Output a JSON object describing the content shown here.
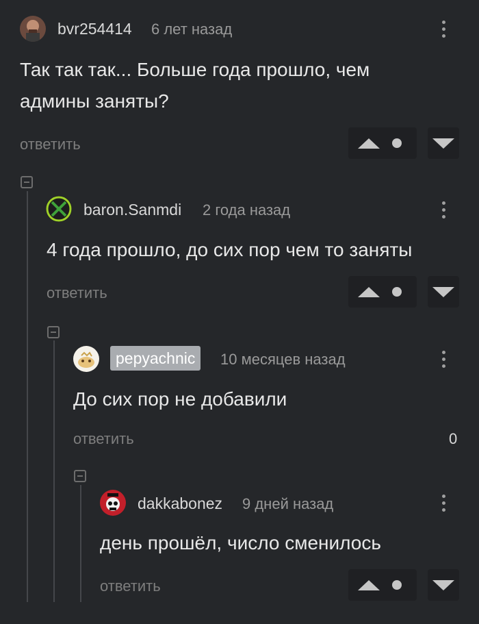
{
  "comments": [
    {
      "username": "bvr254414",
      "time": "6 лет назад",
      "text_line1": "Так так так... Больше года прошло, чем",
      "text_line2": "админы заняты?",
      "reply": "ответить"
    },
    {
      "username": "baron.Sanmdi",
      "time": "2 года назад",
      "text": "4 года прошло, до сих пор чем то заняты",
      "reply": "ответить"
    },
    {
      "username": "pepyachnic",
      "time": "10 месяцев назад",
      "text": "До сих пор не добавили",
      "reply": "ответить",
      "rating": "0"
    },
    {
      "username": "dakkabonez",
      "time": "9 дней назад",
      "text": "день прошёл, число сменилось",
      "reply": "ответить"
    }
  ],
  "icons": {
    "more": "kebab-menu-icon",
    "upvote": "triangle-up-icon",
    "downvote": "triangle-down-icon",
    "save": "dot-icon",
    "collapse": "collapse-minus-icon"
  },
  "colors": {
    "background": "#25272a",
    "vote_box": "#1f2023",
    "badge": "#a9acb0"
  }
}
